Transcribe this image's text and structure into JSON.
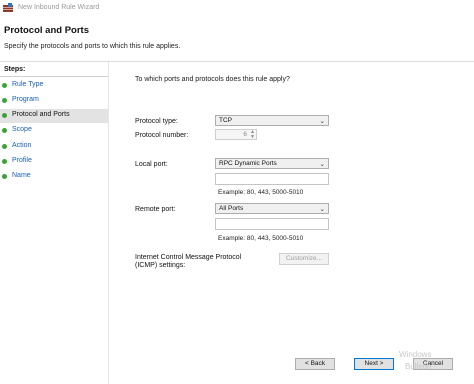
{
  "window": {
    "title": "New Inbound Rule Wizard"
  },
  "header": {
    "title": "Protocol and Ports",
    "description": "Specify the protocols and ports to which this rule applies."
  },
  "sidebar": {
    "title": "Steps:",
    "items": [
      {
        "label": "Rule Type"
      },
      {
        "label": "Program"
      },
      {
        "label": "Protocol and Ports"
      },
      {
        "label": "Scope"
      },
      {
        "label": "Action"
      },
      {
        "label": "Profile"
      },
      {
        "label": "Name"
      }
    ],
    "active_index": 2
  },
  "form": {
    "question": "To which ports and protocols does this rule apply?",
    "protocol_type": {
      "label": "Protocol type:",
      "value": "TCP"
    },
    "protocol_number": {
      "label": "Protocol number:",
      "value": "6"
    },
    "local_port": {
      "label": "Local port:",
      "value": "RPC Dynamic Ports",
      "text": "",
      "example": "Example: 80, 443, 5000-5010"
    },
    "remote_port": {
      "label": "Remote port:",
      "value": "All Ports",
      "text": "",
      "example": "Example: 80, 443, 5000-5010"
    },
    "icmp": {
      "label": "Internet Control Message Protocol\n(ICMP) settings:",
      "button": "Customize..."
    }
  },
  "footer": {
    "back": "< Back",
    "next": "Next >",
    "cancel": "Cancel"
  },
  "watermark": {
    "line1": "Windows",
    "line2": "Bulletin"
  },
  "icons": {
    "window": "firewall-icon",
    "step": "green-dot-icon",
    "dropdown": "chevron-down-icon"
  },
  "colors": {
    "step_dot": "#3aa335",
    "link": "#1a5fb4",
    "active_step": "#e3e3e3"
  }
}
